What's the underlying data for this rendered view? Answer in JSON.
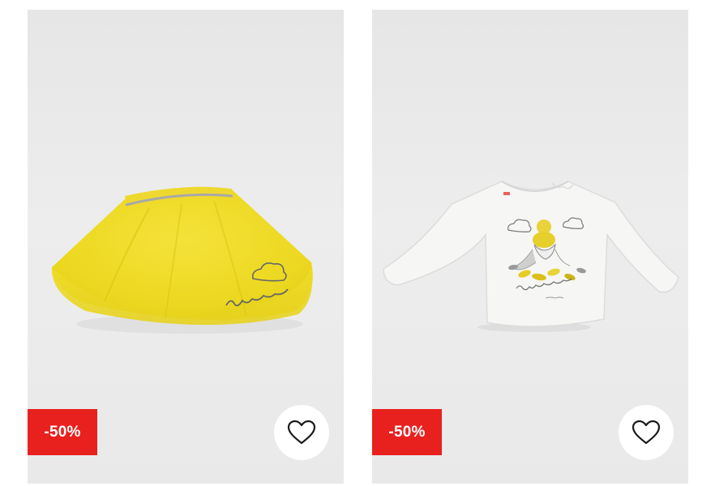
{
  "products": [
    {
      "item": "yellow-tulle-skirt",
      "discount_label": "-50%",
      "wishlist_icon": "heart-outline-icon"
    },
    {
      "item": "white-long-sleeve-top",
      "discount_label": "-50%",
      "wishlist_icon": "heart-outline-icon"
    }
  ],
  "colors": {
    "badge_bg": "#e8211f",
    "badge_text": "#ffffff",
    "card_bg": "#eaeaea",
    "heart_stroke": "#1a1a1a"
  }
}
